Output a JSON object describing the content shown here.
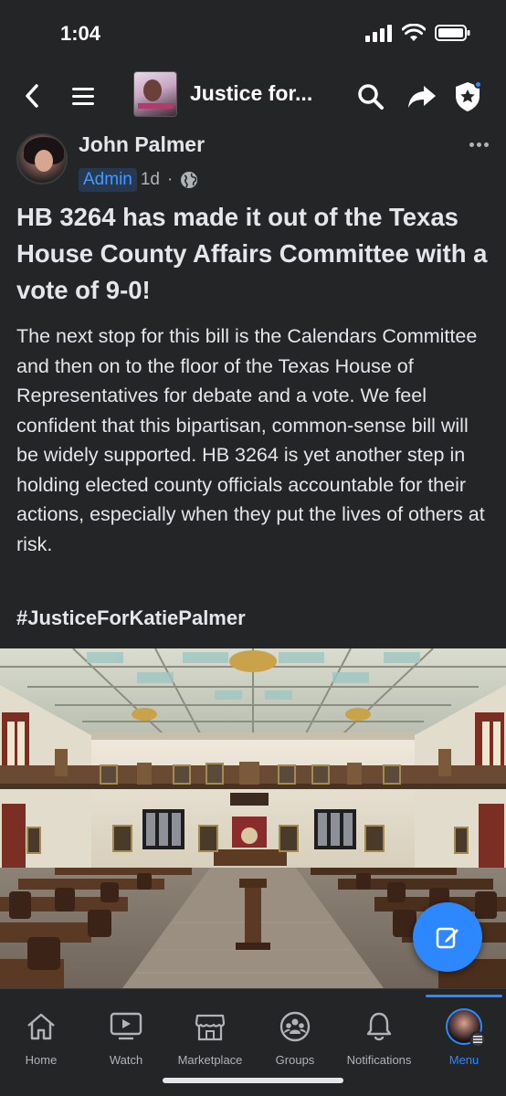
{
  "status_bar": {
    "time": "1:04"
  },
  "navbar": {
    "title": "Justice for...",
    "icons": [
      "back-chevron-icon",
      "menu-icon",
      "search-icon",
      "share-icon",
      "admin-shield-icon"
    ]
  },
  "post": {
    "author": "John Palmer",
    "role_badge": "Admin",
    "time": "1d",
    "separator": "·",
    "headline": "HB 3264 has made it out of the Texas House County Affairs Committee with a vote of 9-0!",
    "body": "The next stop for this bill is the Calendars Committee and then on to the floor of the Texas House of Representatives for debate and a vote.  We feel confident that this bipartisan, common-sense bill will be widely supported.  HB 3264 is yet another step in holding elected county officials accountable for their actions, especially when they put the lives of others at risk.",
    "hashtag": "#JusticeForKatiePalmer"
  },
  "tabs": [
    {
      "label": "Home",
      "icon": "home-icon"
    },
    {
      "label": "Watch",
      "icon": "watch-icon"
    },
    {
      "label": "Marketplace",
      "icon": "marketplace-icon"
    },
    {
      "label": "Groups",
      "icon": "groups-icon"
    },
    {
      "label": "Notifications",
      "icon": "bell-icon"
    },
    {
      "label": "Menu",
      "icon": "profile-avatar",
      "active": true
    }
  ],
  "colors": {
    "accent": "#2d88ff",
    "background": "#242526",
    "text": "#e4e6eb"
  }
}
